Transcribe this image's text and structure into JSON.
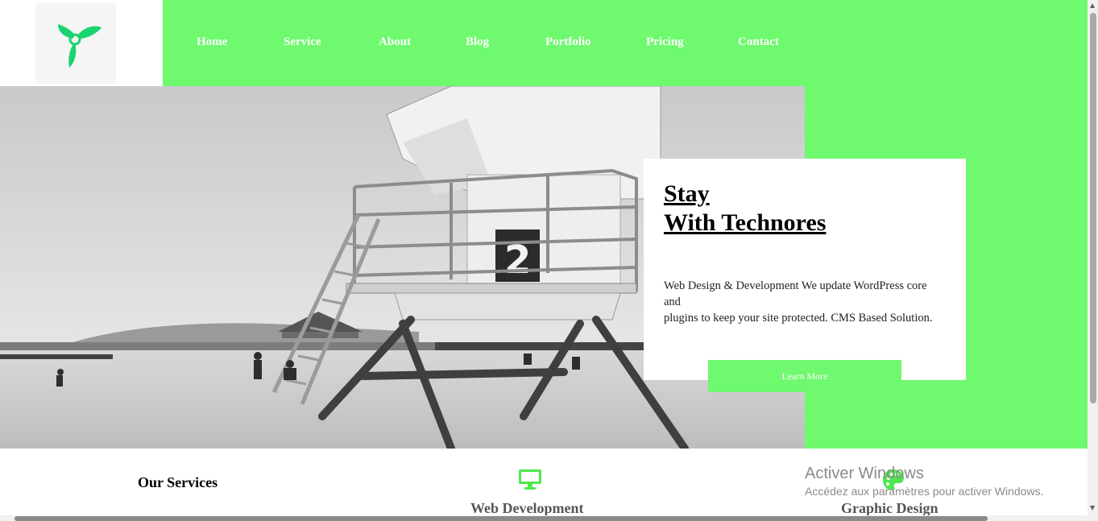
{
  "logo": {
    "icon": "tri-leaf-logo-icon",
    "color": "#19d46f"
  },
  "nav": {
    "items": [
      {
        "label": "Home"
      },
      {
        "label": "Service"
      },
      {
        "label": "About"
      },
      {
        "label": "Blog"
      },
      {
        "label": "Portfolio"
      },
      {
        "label": "Pricing"
      },
      {
        "label": "Contact"
      }
    ]
  },
  "hero": {
    "image": "grayscale-beach-lifeguard-tower-photo",
    "tower_number": "2",
    "title_line1": "Stay",
    "title_line2": "With Technores",
    "description_line1": "Web Design & Development We update WordPress core",
    "description_line2": "and",
    "description_line3": "plugins to keep your site protected. CMS Based Solution.",
    "button_label": "Learn More"
  },
  "services": {
    "heading": "Our Services",
    "items": [
      {
        "label": "Web Development",
        "icon": "monitor-icon"
      },
      {
        "label": "Graphic Design",
        "icon": "palette-icon"
      }
    ]
  },
  "watermark": {
    "title": "Activer Windows",
    "subtitle": "Accédez aux paramètres pour activer Windows."
  },
  "colors": {
    "accent": "#6ff96f",
    "icon_green": "#4ee84e",
    "white": "#ffffff"
  }
}
